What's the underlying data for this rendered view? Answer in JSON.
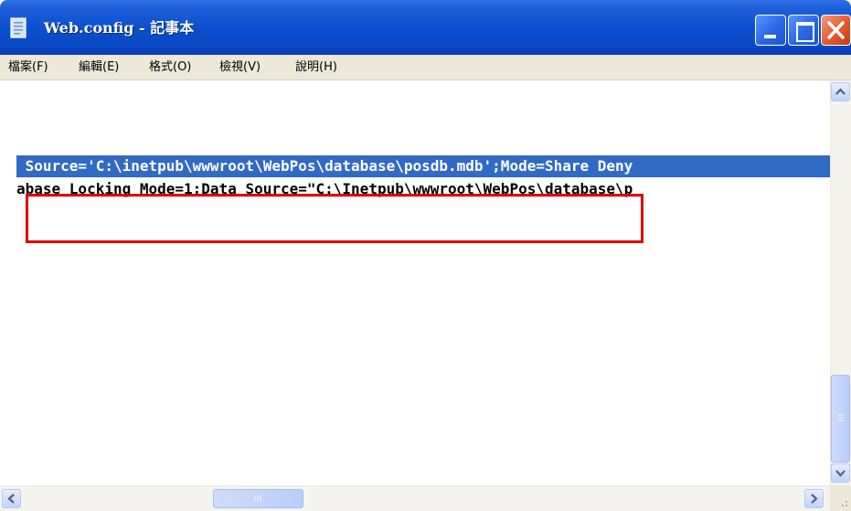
{
  "window": {
    "title": "Web.config - 記事本"
  },
  "menu": {
    "items": [
      {
        "label": "檔案(F)"
      },
      {
        "label": "編輯(E)"
      },
      {
        "label": "格式(O)"
      },
      {
        "label": "檢視(V)"
      },
      {
        "label": "說明(H)"
      }
    ]
  },
  "editor": {
    "lines": [
      {
        "text": "",
        "selected": false
      },
      {
        "text": "",
        "selected": false
      },
      {
        "text": " Source='C:\\inetpub\\wwwroot\\WebPos\\database\\posdb.mdb';Mode=Share Deny",
        "selected": true
      },
      {
        "text": "abase Locking Mode=1;Data Source=\"C:\\Inetpub\\wwwroot\\WebPos\\database\\p",
        "selected": false
      }
    ]
  },
  "colors": {
    "titlebar": "#0a4fcf",
    "selection": "#316ac5",
    "highlight_box": "#e00000",
    "close_button": "#e55a2b"
  },
  "icons": {
    "app": "notepad-icon",
    "minimize": "minimize-icon",
    "maximize": "maximize-icon",
    "close": "close-icon"
  }
}
